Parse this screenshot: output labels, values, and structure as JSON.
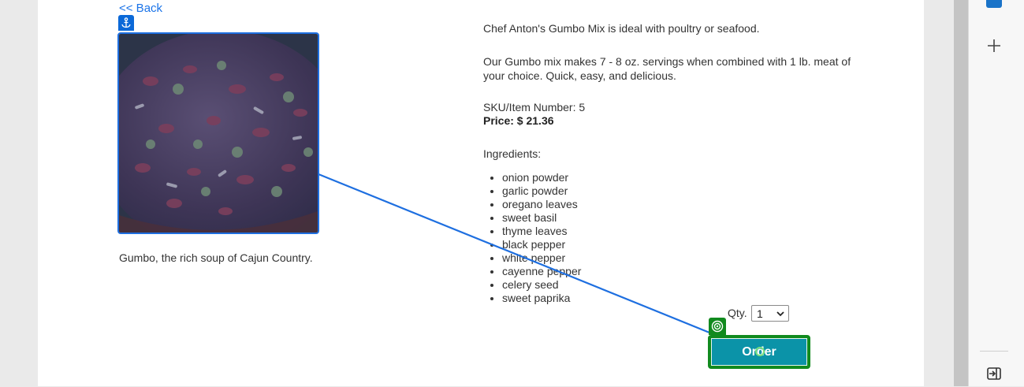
{
  "nav": {
    "back_label": "<< Back"
  },
  "product": {
    "image_caption": "Gumbo, the rich soup of Cajun Country.",
    "description_1": "Chef Anton's Gumbo Mix is ideal with poultry or seafood.",
    "description_2": "Our Gumbo mix makes 7 - 8 oz. servings when combined with 1 lb. meat of your choice. Quick, easy, and delicious.",
    "sku": "SKU/Item Number: 5",
    "price": "Price: $ 21.36",
    "ingredients_title": "Ingredients:",
    "ingredients": [
      "onion powder",
      "garlic powder",
      "oregano leaves",
      "sweet basil",
      "thyme leaves",
      "black pepper",
      "white pepper",
      "cayenne pepper",
      "celery seed",
      "sweet paprika"
    ]
  },
  "order": {
    "qty_label": "Qty.",
    "qty_value": "1",
    "order_label": "Order"
  },
  "icons": {
    "anchor": "anchor-icon",
    "target": "target-icon",
    "add": "plus-icon",
    "collapse": "collapse-sidebar-icon",
    "chevron": "chevron-down-icon"
  },
  "colors": {
    "link": "#1a73e8",
    "anchor_badge": "#0b69d8",
    "target_green": "#118a1e",
    "order_button": "#0b93a8"
  }
}
